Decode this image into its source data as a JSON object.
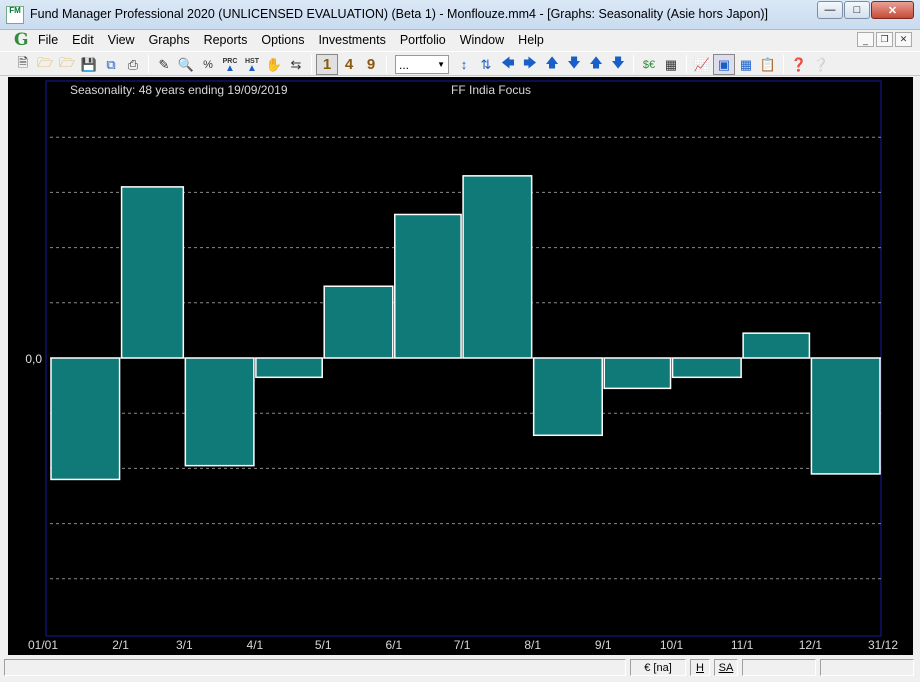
{
  "window": {
    "title": "Fund Manager Professional 2020 (UNLICENSED EVALUATION) (Beta 1) - Monflouze.mm4 - [Graphs: Seasonality (Asie hors Japon)]",
    "app_icon_text": "FM"
  },
  "menu": {
    "logo": "G",
    "items": [
      {
        "label": "File"
      },
      {
        "label": "Edit"
      },
      {
        "label": "View"
      },
      {
        "label": "Graphs"
      },
      {
        "label": "Reports"
      },
      {
        "label": "Options"
      },
      {
        "label": "Investments"
      },
      {
        "label": "Portfolio"
      },
      {
        "label": "Window"
      },
      {
        "label": "Help"
      }
    ]
  },
  "toolbar": {
    "num1": "1",
    "num4": "4",
    "num9": "9",
    "combo_value": "...",
    "prc_label": "PRC",
    "hst_label": "HST"
  },
  "chart": {
    "header_left": "Seasonality: 48 years ending 19/09/2019",
    "header_center": "FF India Focus",
    "zero_label": "0,0",
    "colors": {
      "bar": "#0f7a78",
      "border": "#ffffff",
      "grid": "#8a8a8a",
      "frame": "#1a1aa0",
      "text": "#d8d8d8"
    }
  },
  "chart_data": {
    "type": "bar",
    "categories": [
      "01/01",
      "2/1",
      "3/1",
      "4/1",
      "5/1",
      "6/1",
      "7/1",
      "8/1",
      "9/1",
      "10/1",
      "11/1",
      "12/1",
      "31/12"
    ],
    "values": [
      -2.2,
      3.1,
      -1.95,
      -0.35,
      1.3,
      2.6,
      3.3,
      -1.4,
      -0.55,
      -0.35,
      0.45,
      -2.1
    ],
    "ylim": [
      -5.1,
      5.1
    ],
    "grid": true,
    "gridline_values": [
      -4,
      -3,
      -2,
      -1,
      1,
      2,
      3,
      4
    ],
    "xlabel": "",
    "ylabel": ""
  },
  "statusbar": {
    "currency": "€ [na]",
    "h": "H",
    "sa": "SA"
  }
}
